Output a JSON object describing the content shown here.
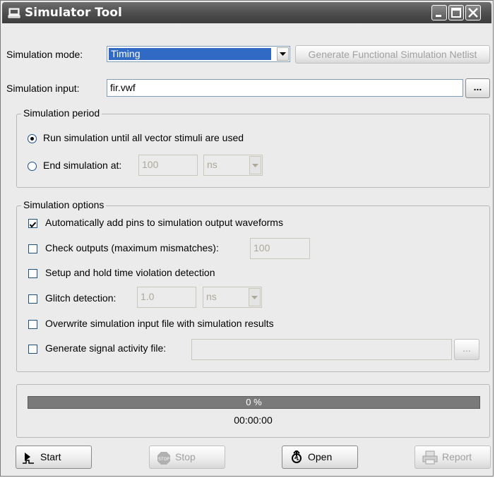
{
  "window": {
    "title": "Simulator Tool"
  },
  "mode": {
    "label": "Simulation mode:",
    "value": "Timing",
    "netlist_button": "Generate Functional Simulation Netlist"
  },
  "input": {
    "label": "Simulation input:",
    "value": "fir.vwf",
    "browse_label": "..."
  },
  "period": {
    "title": "Simulation period",
    "run_all_label": "Run simulation until all vector stimuli are used",
    "end_at_label": "End simulation at:",
    "end_value": "100",
    "end_unit": "ns",
    "selected": "run_all"
  },
  "options": {
    "title": "Simulation options",
    "auto_add_pins": {
      "label": "Automatically add pins to simulation output waveforms",
      "checked": true
    },
    "check_outputs": {
      "label": "Check outputs (maximum mismatches):",
      "checked": false,
      "value": "100"
    },
    "setup_hold": {
      "label": "Setup and hold time violation detection",
      "checked": false
    },
    "glitch": {
      "label": "Glitch detection:",
      "checked": false,
      "value": "1.0",
      "unit": "ns"
    },
    "overwrite": {
      "label": "Overwrite simulation input file with simulation results",
      "checked": false
    },
    "signal_activity": {
      "label": "Generate signal activity file:",
      "checked": false,
      "value": "",
      "browse_label": "..."
    }
  },
  "progress": {
    "percent_text": "0 %",
    "percent_value": 0,
    "elapsed": "00:00:00"
  },
  "buttons": {
    "start": "Start",
    "stop": "Stop",
    "open": "Open",
    "report": "Report"
  }
}
